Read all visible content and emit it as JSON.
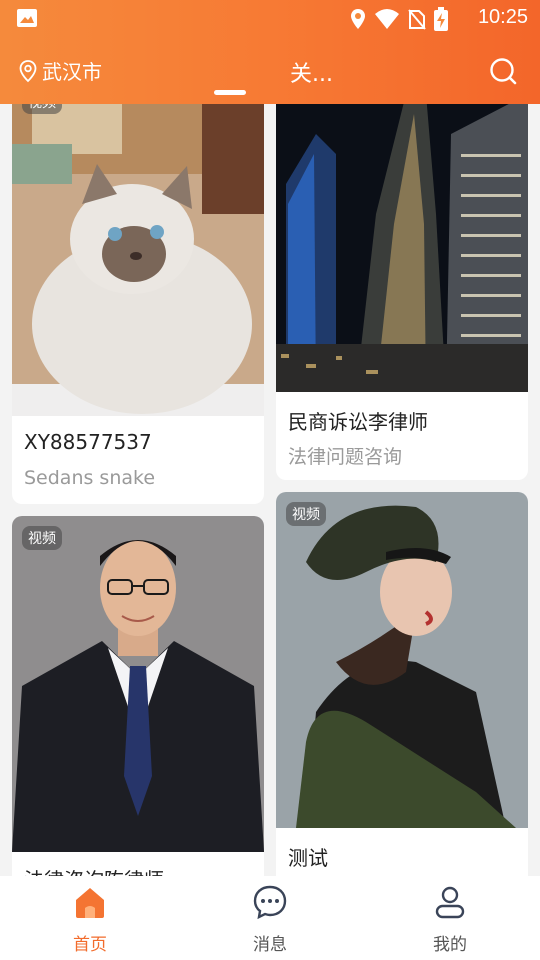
{
  "status_bar": {
    "time": "10:25"
  },
  "header": {
    "location": "武汉市",
    "tab_title": "关...",
    "icons": {
      "location": "location-pin-icon",
      "search": "search-icon"
    },
    "accent": "#f47432"
  },
  "feed": {
    "cards": [
      {
        "badge": "视频",
        "title": "XY88577537",
        "subtitle": "Sedans snake",
        "image": "cat-photo"
      },
      {
        "badge": "",
        "title": "民商诉讼李律师",
        "subtitle": "法律问题咨询",
        "image": "city-skyscrapers-photo"
      },
      {
        "badge": "视频",
        "title": "法律咨询陈律师",
        "subtitle": "",
        "image": "man-in-suit-photo"
      },
      {
        "badge": "视频",
        "title": "测试",
        "subtitle": "",
        "image": "woman-in-beret-photo"
      }
    ]
  },
  "bottom_nav": {
    "items": [
      {
        "label": "首页",
        "icon": "home-icon",
        "active": true
      },
      {
        "label": "消息",
        "icon": "chat-bubble-icon",
        "active": false
      },
      {
        "label": "我的",
        "icon": "person-icon",
        "active": false
      }
    ],
    "active_color": "#f26c2c"
  }
}
